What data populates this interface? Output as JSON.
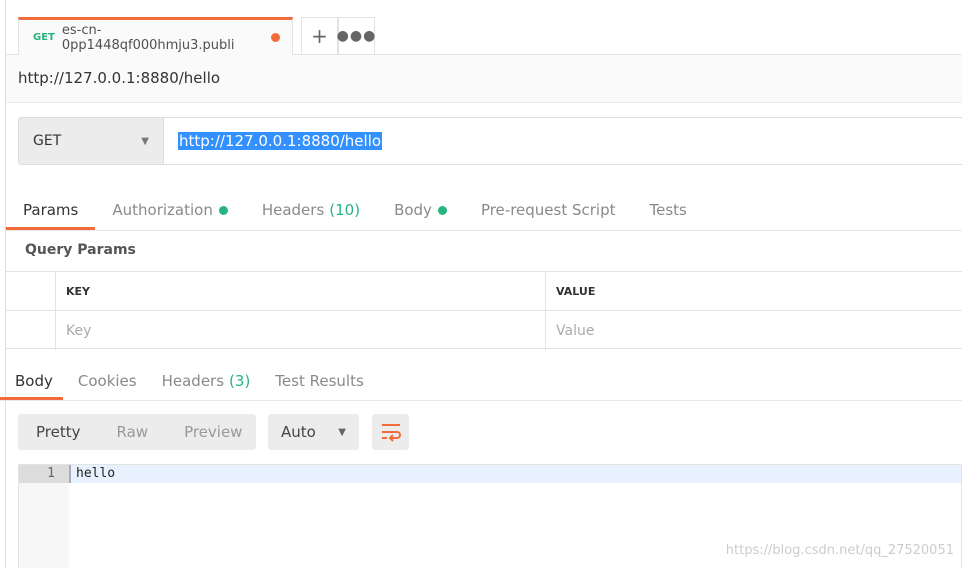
{
  "tab": {
    "method": "GET",
    "title": "es-cn-0pp1448qf000hmju3.publi"
  },
  "request_title": "http://127.0.0.1:8880/hello",
  "method": "GET",
  "url": "http://127.0.0.1:8880/hello",
  "request_tabs": [
    {
      "label": "Params"
    },
    {
      "label": "Authorization"
    },
    {
      "label": "Headers",
      "count": "(10)"
    },
    {
      "label": "Body"
    },
    {
      "label": "Pre-request Script"
    },
    {
      "label": "Tests"
    }
  ],
  "query_params": {
    "title": "Query Params",
    "key_header": "KEY",
    "value_header": "VALUE",
    "key_placeholder": "Key",
    "value_placeholder": "Value"
  },
  "response_tabs": [
    {
      "label": "Body"
    },
    {
      "label": "Cookies"
    },
    {
      "label": "Headers",
      "count": "(3)"
    },
    {
      "label": "Test Results"
    }
  ],
  "view_modes": [
    "Pretty",
    "Raw",
    "Preview"
  ],
  "format": "Auto",
  "body": {
    "line_number": "1",
    "content": "hello"
  },
  "watermark": "https://blog.csdn.net/qq_27520051",
  "colors": {
    "accent": "#f26b3a",
    "green": "#26b47f"
  }
}
